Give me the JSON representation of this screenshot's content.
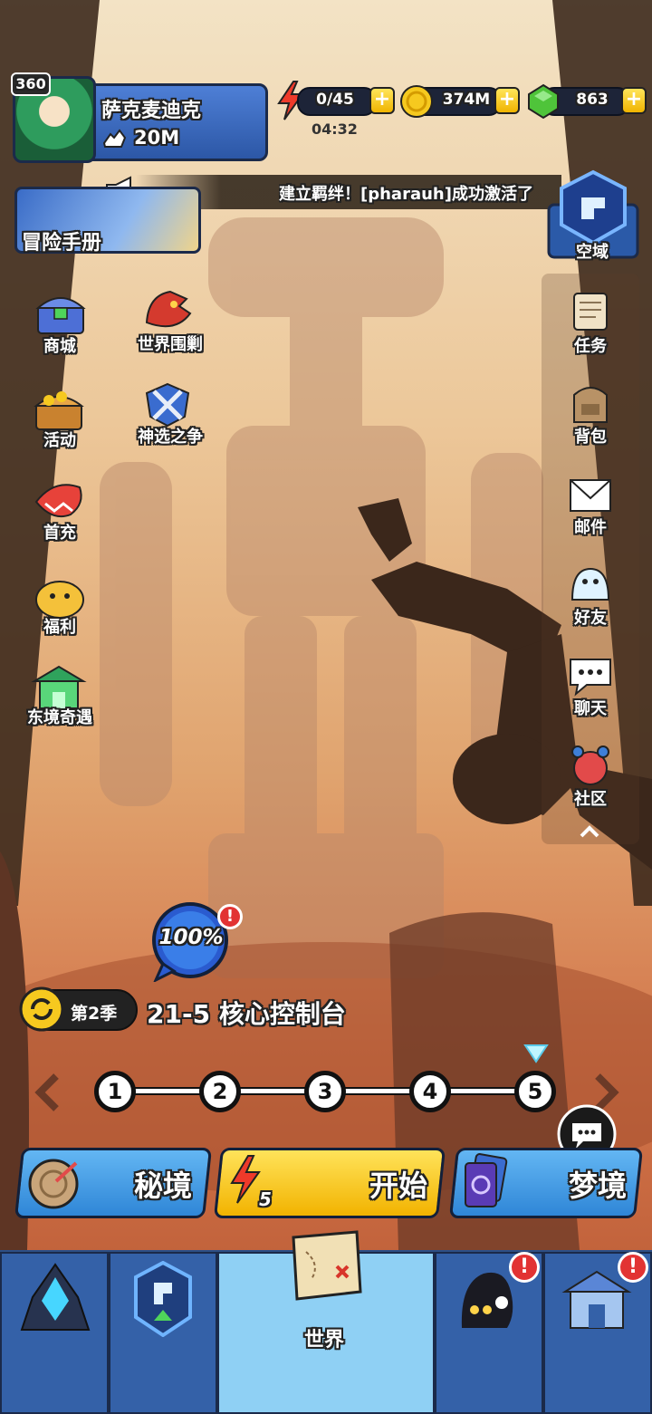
{
  "player": {
    "level": "360",
    "name": "萨克麦迪克",
    "power": "20M"
  },
  "resources": {
    "energy": "0/45",
    "energy_timer": "04:32",
    "gold": "374M",
    "gems": "863",
    "plus": "+"
  },
  "ticker": {
    "text": "建立羁绊！[pharauh]成功激活了"
  },
  "adventure": {
    "label": "冒险手册"
  },
  "sky_domain": {
    "label": "空域"
  },
  "left_menu": [
    {
      "label": "商城",
      "icon": "chest-icon"
    },
    {
      "label": "世界围剿",
      "icon": "dragon-icon"
    },
    {
      "label": "活动",
      "icon": "treasure-icon"
    },
    {
      "label": "神选之争",
      "icon": "crossed-swords-icon"
    },
    {
      "label": "首充",
      "icon": "fish-icon"
    },
    {
      "label": "福利",
      "icon": "piggy-bank-icon"
    },
    {
      "label": "东境奇遇",
      "icon": "pagoda-icon"
    }
  ],
  "right_menu": [
    {
      "label": "任务",
      "icon": "scroll-icon"
    },
    {
      "label": "背包",
      "icon": "backpack-icon"
    },
    {
      "label": "邮件",
      "icon": "mail-icon"
    },
    {
      "label": "好友",
      "icon": "friends-icon"
    },
    {
      "label": "聊天",
      "icon": "chat-icon"
    },
    {
      "label": "社区",
      "icon": "community-icon"
    }
  ],
  "progress": {
    "percent": "100%"
  },
  "season": {
    "label": "第2季",
    "stage": "21-5 核心控制台"
  },
  "stages": [
    "1",
    "2",
    "3",
    "4",
    "5"
  ],
  "actions": {
    "secret": "秘境",
    "start": "开始",
    "start_cost": "5",
    "dream": "梦境"
  },
  "bottom_nav": {
    "world": "世界",
    "alert": "!"
  },
  "colors": {
    "accent_blue": "#3e7fd8",
    "accent_yellow": "#f6c91f",
    "dark_outline": "#1b2a4a"
  }
}
